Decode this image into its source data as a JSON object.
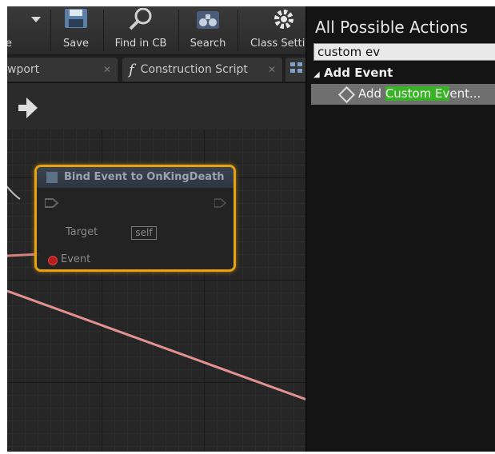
{
  "toolbar": {
    "left_fragment": "e",
    "buttons": [
      {
        "label": "Save",
        "icon": "floppy-icon"
      },
      {
        "label": "Find in CB",
        "icon": "magnifier-icon"
      },
      {
        "label": "Search",
        "icon": "binoculars-icon"
      },
      {
        "label": "Class Setti",
        "icon": "gear-icon"
      }
    ]
  },
  "tabs": {
    "viewport": "wport",
    "construction": "Construction Script",
    "function_glyph": "f"
  },
  "node": {
    "title": "Bind Event to OnKingDeath",
    "target_label": "Target",
    "target_value": "self",
    "event_label": "Event",
    "border_color": "#e6a20f"
  },
  "panel": {
    "title": "All Possible Actions",
    "search_value": "custom ev",
    "category": "Add Event",
    "category_arrow": "◢",
    "result_prefix": "Add ",
    "result_highlight": "Custom Ev",
    "result_suffix": "ent...",
    "highlight_color": "#39b326"
  }
}
